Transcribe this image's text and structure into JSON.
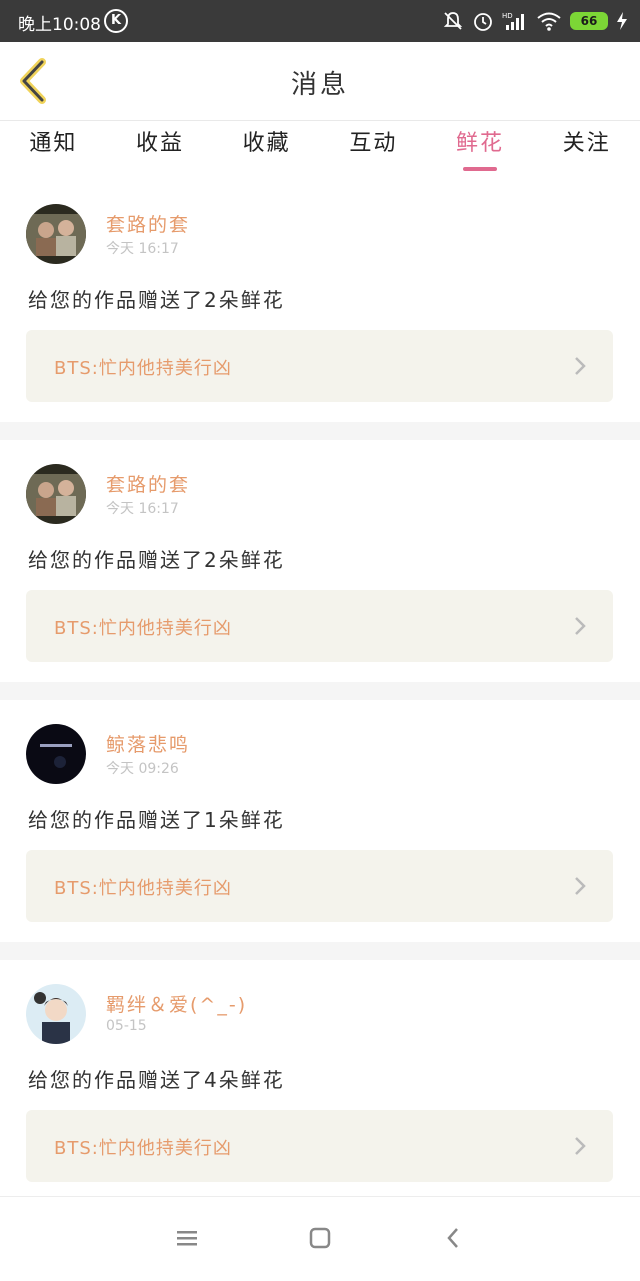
{
  "status_bar": {
    "time": "晚上10:08",
    "k_badge": "K",
    "battery": "66",
    "icons": [
      "mute-bell-icon",
      "alarm-icon",
      "hd-signal-icon",
      "wifi-icon",
      "battery-icon",
      "charging-bolt-icon"
    ]
  },
  "header": {
    "title": "消息",
    "back_icon": "back-arrow-icon"
  },
  "tabs": [
    {
      "label": "通知"
    },
    {
      "label": "收益"
    },
    {
      "label": "收藏"
    },
    {
      "label": "互动"
    },
    {
      "label": "鲜花",
      "active": true
    },
    {
      "label": "关注"
    }
  ],
  "colors": {
    "accent_pink": "#e06a8f",
    "name_orange": "#e69b6c",
    "work_bg": "#f4f3ec"
  },
  "messages": [
    {
      "user": "套路的套",
      "time": "今天 16:17",
      "text": "给您的作品赠送了2朵鲜花",
      "work": "BTS:忙内他持美行凶"
    },
    {
      "user": "套路的套",
      "time": "今天 16:17",
      "text": "给您的作品赠送了2朵鲜花",
      "work": "BTS:忙内他持美行凶"
    },
    {
      "user": "鲸落悲鸣",
      "time": "今天 09:26",
      "text": "给您的作品赠送了1朵鲜花",
      "work": "BTS:忙内他持美行凶"
    },
    {
      "user": "羁绊＆爱(^_-)",
      "time": "05-15",
      "text": "给您的作品赠送了4朵鲜花",
      "work": "BTS:忙内他持美行凶"
    }
  ],
  "nav": [
    "menu-icon",
    "home-square-icon",
    "back-chevron-icon"
  ]
}
